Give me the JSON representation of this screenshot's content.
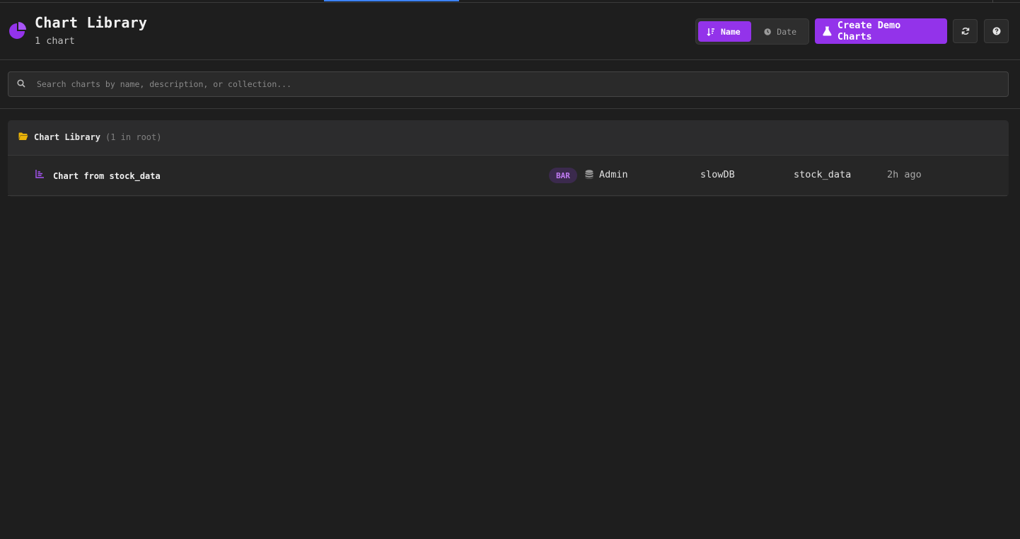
{
  "header": {
    "title": "Chart Library",
    "subtitle": "1 chart",
    "sort": {
      "name_label": "Name",
      "date_label": "Date",
      "active": "name"
    },
    "demo_button_label": "Create Demo Charts"
  },
  "search": {
    "placeholder": "Search charts by name, description, or collection...",
    "value": ""
  },
  "library": {
    "title": "Chart Library",
    "count_label": "(1 in root)",
    "charts": [
      {
        "name": "Chart from stock_data",
        "type_badge": "BAR",
        "owner": "Admin",
        "database": "slowDB",
        "table": "stock_data",
        "updated": "2h ago"
      }
    ]
  },
  "colors": {
    "accent": "#9333ea",
    "tab_indicator": "#3b82f6",
    "folder": "#eab308",
    "background": "#1e1e1e"
  }
}
